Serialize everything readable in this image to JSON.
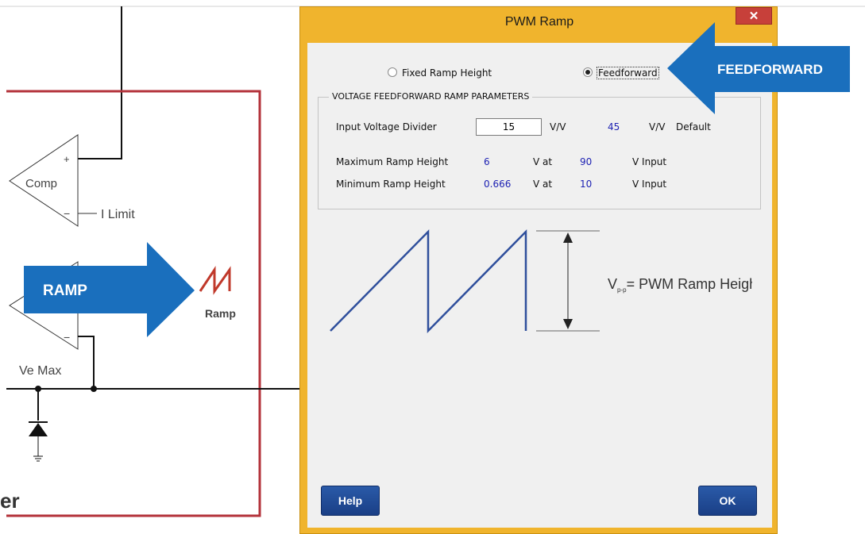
{
  "background": {
    "comp_label": "Comp",
    "comp_plus": "+",
    "comp_minus": "−",
    "ilimit_label": "I Limit",
    "ramp_label": "Ramp",
    "ve_max_label": "Ve Max",
    "partial_word": "er",
    "minus_sign": "−"
  },
  "dialog": {
    "title": "PWM Ramp",
    "close_glyph": "✕",
    "radio_fixed_label": "Fixed Ramp Height",
    "radio_feedforward_label": "Feedforward",
    "selected_mode": "Feedforward",
    "group_title": "VOLTAGE FEEDFORWARD RAMP PARAMETERS",
    "input_divider": {
      "label": "Input Voltage Divider",
      "value": "15",
      "unit": "V/V",
      "default_value": "45",
      "default_unit": "V/V",
      "default_label": "Default"
    },
    "max_ramp": {
      "label": "Maximum Ramp Height",
      "value": "6",
      "v_at": "V at",
      "input_value": "90",
      "input_unit": "V Input"
    },
    "min_ramp": {
      "label": "Minimum Ramp Height",
      "value": "0.666",
      "v_at": "V at",
      "input_value": "10",
      "input_unit": "V Input"
    },
    "diagram_label_v": "V",
    "diagram_label_sub": "p-p",
    "diagram_label_rest": "= PWM Ramp Height",
    "help_button": "Help",
    "ok_button": "OK"
  },
  "callouts": {
    "ramp": "RAMP",
    "feedforward": "FEEDFORWARD"
  },
  "colors": {
    "dialog_frame": "#f0b42d",
    "callout_blue": "#1a6fbd",
    "schematic_red": "#c0392b",
    "ramp_wave": "#2f4f9c",
    "value_blue": "#1e22b3"
  }
}
